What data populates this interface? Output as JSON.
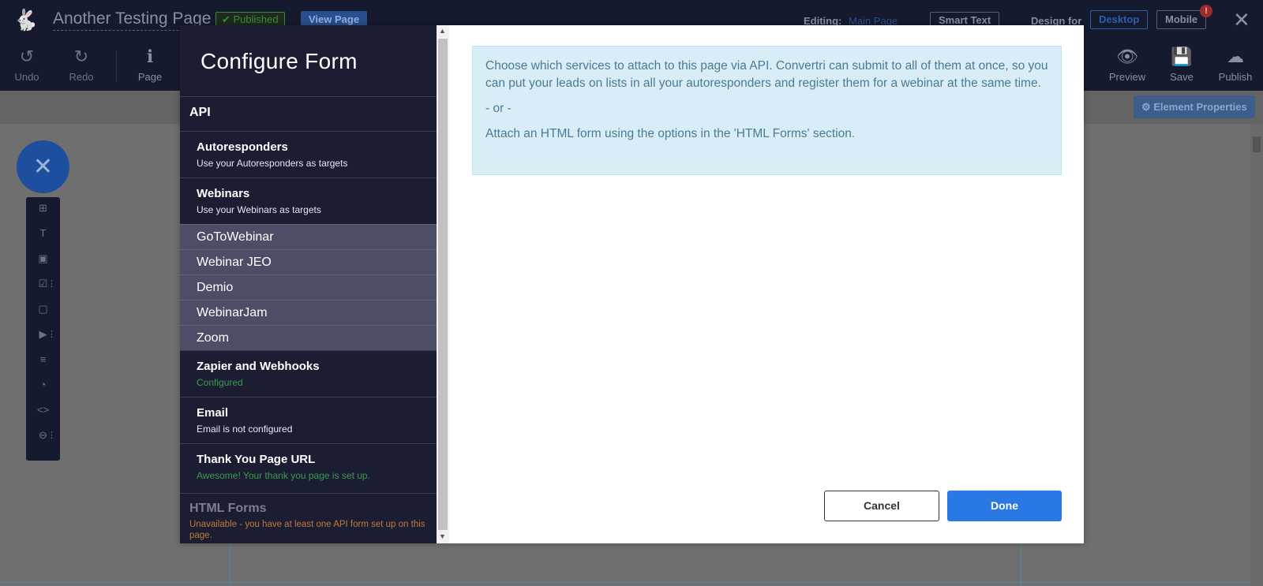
{
  "app": {
    "page_title": "Another Testing Page",
    "published_badge": "✔ Published",
    "view_page_label": "View Page",
    "editing_label": "Editing:",
    "editing_link": "Main Page",
    "smart_text_label": "Smart Text",
    "design_for_label": "Design for",
    "desktop_label": "Desktop",
    "mobile_label": "Mobile",
    "mobile_alert": "!",
    "close_glyph": "✕",
    "logo_glyph": "🐇"
  },
  "toolbar": {
    "undo": {
      "label": "Undo",
      "icon": "↺"
    },
    "redo": {
      "label": "Redo",
      "icon": "↻"
    },
    "page": {
      "label": "Page",
      "icon": "ℹ"
    },
    "preview": {
      "label": "Preview",
      "icon": "👁"
    },
    "save": {
      "label": "Save",
      "icon": "💾"
    },
    "publish": {
      "label": "Publish",
      "icon": "☁"
    }
  },
  "canvas": {
    "element_properties_label": "⚙ Element Properties",
    "fab_glyph": "✕",
    "side_tools": [
      {
        "name": "section-tool",
        "glyph": "⊞",
        "dots": ""
      },
      {
        "name": "text-tool",
        "glyph": "T",
        "dots": ""
      },
      {
        "name": "image-tool",
        "glyph": "▣",
        "dots": ""
      },
      {
        "name": "form-tool",
        "glyph": "☑",
        "dots": "⋮"
      },
      {
        "name": "box-tool",
        "glyph": "▢",
        "dots": ""
      },
      {
        "name": "video-tool",
        "glyph": "▶",
        "dots": "⋮"
      },
      {
        "name": "list-tool",
        "glyph": "≡",
        "dots": ""
      },
      {
        "name": "timer-tool",
        "glyph": "◔",
        "dots": ""
      },
      {
        "name": "code-tool",
        "glyph": "<>",
        "dots": ""
      },
      {
        "name": "divider-tool",
        "glyph": "⊖",
        "dots": "⋮"
      }
    ]
  },
  "modal": {
    "title": "Configure Form",
    "api_heading": "API",
    "autoresponders": {
      "title": "Autoresponders",
      "subtitle": "Use your Autoresponders as targets"
    },
    "webinars": {
      "title": "Webinars",
      "subtitle": "Use your Webinars as targets"
    },
    "webinar_services": [
      "GoToWebinar",
      "Webinar JEO",
      "Demio",
      "WebinarJam",
      "Zoom"
    ],
    "zapier": {
      "title": "Zapier and Webhooks",
      "subtitle": "Configured"
    },
    "email": {
      "title": "Email",
      "subtitle": "Email is not configured"
    },
    "thank_you": {
      "title": "Thank You Page URL",
      "subtitle": "Awesome! Your thank you page is set up."
    },
    "html_forms": {
      "title": "HTML Forms",
      "subtitle": "Unavailable - you have at least one API form set up on this page."
    },
    "info": {
      "p1": "Choose which services to attach to this page via API. Convertri can submit to all of them at once, so you can put your leads on lists in all your autoresponders and register them for a webinar at the same time.",
      "or": "- or -",
      "p2": "Attach an HTML form using the options in the 'HTML Forms' section."
    },
    "cancel_label": "Cancel",
    "done_label": "Done"
  },
  "colors": {
    "topbar_bg": "#161a2e",
    "sidebar_bg": "#1b1d33",
    "sub_item_bg": "#4b4e66",
    "info_bg": "#d9edf7",
    "done_blue": "#2a78e4",
    "success_green": "#3b9b4a",
    "warning_orange": "#c07a3a"
  }
}
